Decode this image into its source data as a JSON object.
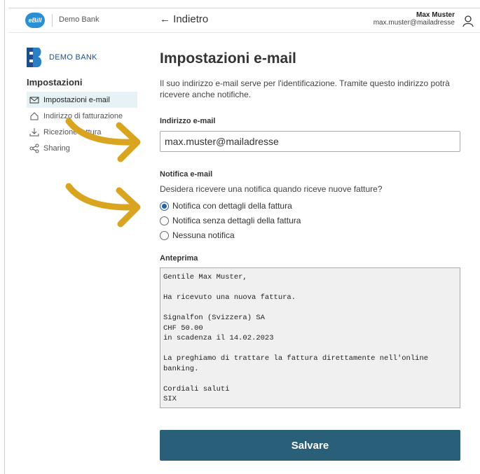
{
  "header": {
    "logo_text": "eBill",
    "bank_name": "Demo Bank",
    "back_label": "← Indietro",
    "user_name": "Max Muster",
    "user_email": "max.muster@mailadresse",
    "user_icon": "user-icon"
  },
  "sidebar": {
    "bank_logo_text": "DEMO BANK",
    "title": "Impostazioni",
    "items": [
      {
        "label": "Impostazioni e-mail",
        "icon": "envelope-icon",
        "active": true
      },
      {
        "label": "Indirizzo di fatturazione",
        "icon": "home-icon",
        "active": false
      },
      {
        "label": "Ricezione fattura",
        "icon": "download-icon",
        "active": false
      },
      {
        "label": "Sharing",
        "icon": "share-icon",
        "active": false
      }
    ]
  },
  "main": {
    "title": "Impostazioni e-mail",
    "intro": "Il suo indirizzo e-mail serve per l'identificazione. Tramite questo indirizzo potrà ricevere anche notifiche.",
    "email_label": "Indirizzo e-mail",
    "email_value": "max.muster@mailadresse",
    "notification_label": "Notifica e-mail",
    "notification_question": "Desidera ricevere una notifica quando riceve nuove fatture?",
    "options": [
      {
        "label": "Notifica con dettagli della fattura",
        "checked": true
      },
      {
        "label": "Notifica senza dettagli della fattura",
        "checked": false
      },
      {
        "label": "Nessuna notifica",
        "checked": false
      }
    ],
    "preview_label": "Anteprima",
    "preview_text": "Gentile Max Muster,\n\nHa ricevuto una nuova fattura.\n\nSignalfon (Svizzera) SA\nCHF 50.00\nin scadenza il 14.02.2023\n\nLa preghiamo di trattare la fattura direttamente nell'online\nbanking.\n\nCordiali saluti\nSIX",
    "save_label": "Salvare"
  },
  "colors": {
    "ebill_blue": "#2b8fd3",
    "save_button": "#2a5f79",
    "active_item_bg": "#e6f2f6",
    "annotation_arrow": "#d9a520"
  }
}
